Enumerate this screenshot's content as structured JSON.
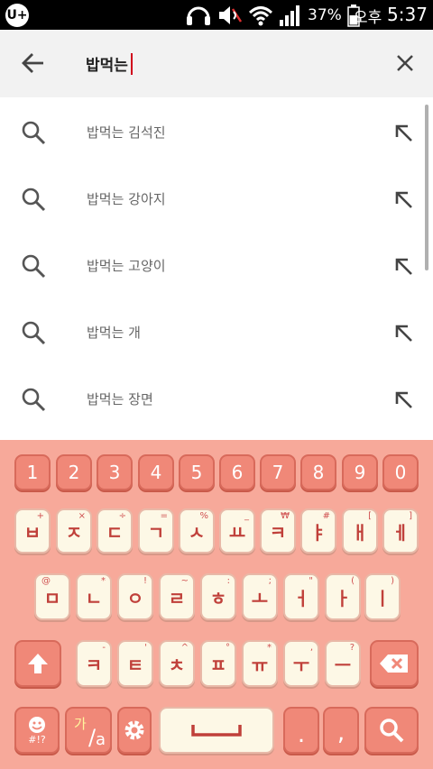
{
  "status_bar": {
    "logo": "U+",
    "battery_percent": "37%",
    "ampm": "오후",
    "time": "5:37"
  },
  "search": {
    "query": "밥먹는"
  },
  "suggestions": [
    "밥먹는 김석진",
    "밥먹는 강아지",
    "밥먹는 고양이",
    "밥먹는 개",
    "밥먹는 장면"
  ],
  "keyboard": {
    "number_row": [
      "1",
      "2",
      "3",
      "4",
      "5",
      "6",
      "7",
      "8",
      "9",
      "0"
    ],
    "row1": [
      {
        "main": "ㅂ",
        "sec": "+"
      },
      {
        "main": "ㅈ",
        "sec": "×"
      },
      {
        "main": "ㄷ",
        "sec": "÷"
      },
      {
        "main": "ㄱ",
        "sec": "="
      },
      {
        "main": "ㅅ",
        "sec": "%"
      },
      {
        "main": "ㅛ",
        "sec": "_"
      },
      {
        "main": "ㅋ",
        "sec": "₩"
      },
      {
        "main": "ㅑ",
        "sec": "#"
      },
      {
        "main": "ㅐ",
        "sec": "["
      },
      {
        "main": "ㅔ",
        "sec": "]"
      }
    ],
    "row2": [
      {
        "main": "ㅁ",
        "sec": "@"
      },
      {
        "main": "ㄴ",
        "sec": "*"
      },
      {
        "main": "ㅇ",
        "sec": "!"
      },
      {
        "main": "ㄹ",
        "sec": "~"
      },
      {
        "main": "ㅎ",
        "sec": ":"
      },
      {
        "main": "ㅗ",
        "sec": ";"
      },
      {
        "main": "ㅓ",
        "sec": "\""
      },
      {
        "main": "ㅏ",
        "sec": "("
      },
      {
        "main": "ㅣ",
        "sec": ")"
      }
    ],
    "row3": [
      {
        "main": "ㅋ",
        "sec": "-"
      },
      {
        "main": "ㅌ",
        "sec": "'"
      },
      {
        "main": "ㅊ",
        "sec": "^"
      },
      {
        "main": "ㅍ",
        "sec": "°"
      },
      {
        "main": "ㅠ",
        "sec": "*"
      },
      {
        "main": "ㅜ",
        "sec": ","
      },
      {
        "main": "ㅡ",
        "sec": "?"
      }
    ],
    "emoji_label": "#!?",
    "lang_label_top": "가",
    "lang_label_bottom": "a",
    "period_key": ".",
    "comma_key": ",",
    "colors": {
      "background": "#f7a99a",
      "number_key": "#f08878",
      "letter_key": "#fdf8e6",
      "letter_text": "#c0403a"
    }
  }
}
